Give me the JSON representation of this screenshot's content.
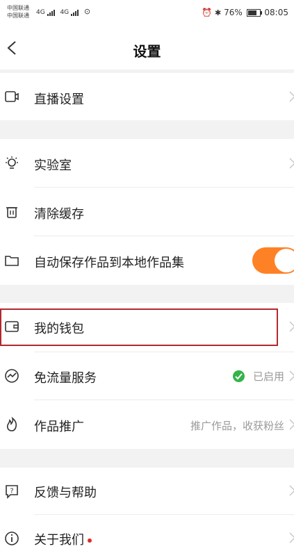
{
  "status_bar": {
    "carrier1": "中国联通",
    "carrier2": "中国联通",
    "net1": "4G",
    "net2": "4G",
    "battery_pct": "76%",
    "battery_level": 0.76,
    "time": "08:05"
  },
  "nav": {
    "title": "设置",
    "back_icon": "back-arrow-icon"
  },
  "rows": {
    "live": {
      "label": "直播设置",
      "icon": "camera-icon"
    },
    "lab": {
      "label": "实验室",
      "icon": "lightbulb-icon"
    },
    "cache": {
      "label": "清除缓存",
      "icon": "trash-icon"
    },
    "autosave": {
      "label": "自动保存作品到本地作品集",
      "icon": "folder-icon",
      "toggle_on": true,
      "toggle_color": "#ff8125"
    },
    "wallet": {
      "label": "我的钱包",
      "icon": "wallet-icon"
    },
    "free_data": {
      "label": "免流量服务",
      "icon": "data-icon",
      "status": "已启用"
    },
    "promote": {
      "label": "作品推广",
      "icon": "flame-icon",
      "status": "推广作品，收获粉丝"
    },
    "feedback": {
      "label": "反馈与帮助",
      "icon": "help-icon"
    },
    "about": {
      "label": "关于我们",
      "icon": "info-icon"
    }
  },
  "colors": {
    "highlight_border": "#b3282d",
    "enabled_check": "#34b34a",
    "notify_dot": "#e02a2a"
  }
}
